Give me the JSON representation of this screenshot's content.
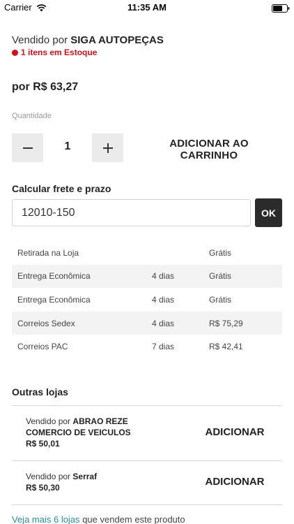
{
  "status_bar": {
    "carrier": "Carrier",
    "time": "11:35 AM"
  },
  "seller": {
    "prefix": "Vendido por",
    "name": "SIGA AUTOPEÇAS",
    "stock": "1 itens em Estoque"
  },
  "price": "por R$ 63,27",
  "quantity": {
    "label": "Quantidade",
    "value": "1"
  },
  "add_to_cart_label": "ADICIONAR AO CARRINHO",
  "freight": {
    "title": "Calcular frete e prazo",
    "cep_value": "12010-150",
    "ok_label": "OK",
    "options": [
      {
        "name": "Retirada na Loja",
        "days": "",
        "price": "Grátis"
      },
      {
        "name": "Entrega Econômica",
        "days": "4 dias",
        "price": "Grátis"
      },
      {
        "name": "Entrega Econômica",
        "days": "4 dias",
        "price": "Grátis"
      },
      {
        "name": "Correios Sedex",
        "days": "4 dias",
        "price": "R$ 75,29"
      },
      {
        "name": "Correios PAC",
        "days": "7 dias",
        "price": "R$ 42,41"
      }
    ]
  },
  "other_stores": {
    "title": "Outras lojas",
    "offers": [
      {
        "prefix": "Vendido por",
        "seller_line1": "ABRAO REZE",
        "seller_line2": "COMERCIO DE VEICULOS",
        "price": "R$ 50,01",
        "button": "ADICIONAR"
      },
      {
        "prefix": "Vendido por",
        "seller_line1": "Serraf",
        "seller_line2": "",
        "price": "R$ 50,30",
        "button": "ADICIONAR"
      }
    ],
    "see_more_link": "Veja mais 6 lojas",
    "see_more_rest": "que vendem este produto"
  }
}
